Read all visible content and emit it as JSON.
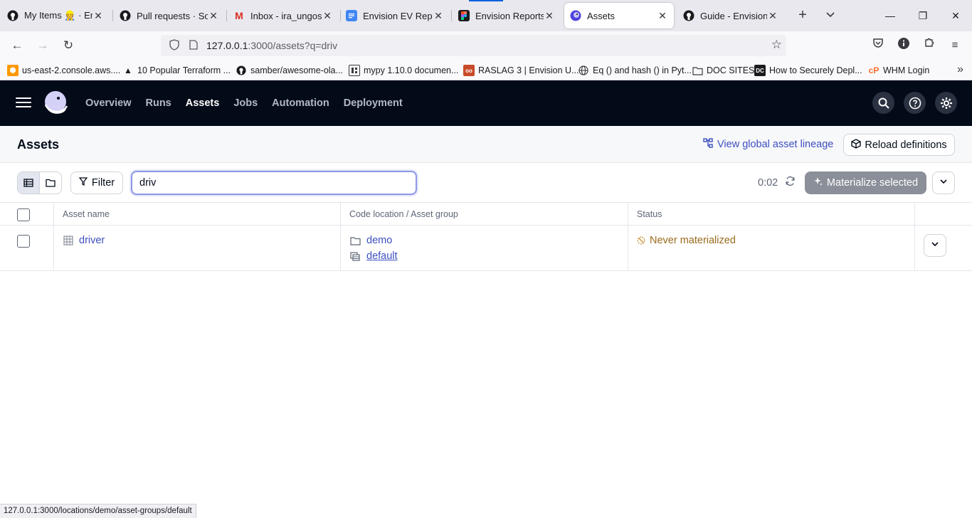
{
  "browser": {
    "tabs": [
      {
        "title": "My Items 👷 · Envis",
        "icon": "github-icon",
        "active": false
      },
      {
        "title": "Pull requests · Sole",
        "icon": "github-icon",
        "active": false
      },
      {
        "title": "Inbox - ira_ungos@",
        "icon": "gmail-icon",
        "active": false
      },
      {
        "title": "Envision EV Report",
        "icon": "google-docs-icon",
        "active": false
      },
      {
        "title": "Envision Reports –",
        "icon": "figma-icon",
        "active": false
      },
      {
        "title": "Assets",
        "icon": "dagster-icon",
        "active": true
      },
      {
        "title": "Guide - Envision EV",
        "icon": "github-icon",
        "active": false
      }
    ],
    "url_host": "127.0.0.1",
    "url_path": ":3000/assets?q=driv",
    "bookmarks": [
      {
        "label": "us-east-2.console.aws....",
        "icon": "aws-icon"
      },
      {
        "label": "10 Popular Terraform ...",
        "icon": "terraform-icon"
      },
      {
        "label": "samber/awesome-ola...",
        "icon": "github-icon"
      },
      {
        "label": "mypy 1.10.0 documen...",
        "icon": "mypy-icon"
      },
      {
        "label": "RASLAG 3 | Envision U...",
        "icon": "raslag-icon"
      },
      {
        "label": "Eq () and hash () in Pyt...",
        "icon": "globe-icon"
      },
      {
        "label": "DOC SITES",
        "icon": "folder-icon"
      },
      {
        "label": "How to Securely Depl...",
        "icon": "dc-icon"
      },
      {
        "label": "WHM Login",
        "icon": "cpanel-icon"
      }
    ],
    "status_url": "127.0.0.1:3000/locations/demo/asset-groups/default"
  },
  "app": {
    "nav": [
      "Overview",
      "Runs",
      "Assets",
      "Jobs",
      "Automation",
      "Deployment"
    ],
    "active_nav": "Assets"
  },
  "page": {
    "title": "Assets",
    "lineage_link": "View global asset lineage",
    "reload_button": "Reload definitions"
  },
  "toolbar": {
    "filter_label": "Filter",
    "search_value": "driv",
    "refresh_time": "0:02",
    "materialize_label": "Materialize selected"
  },
  "table": {
    "columns": [
      "Asset name",
      "Code location / Asset group",
      "Status"
    ],
    "rows": [
      {
        "asset_name": "driver",
        "code_location": "demo",
        "asset_group": "default",
        "status": "Never materialized"
      }
    ]
  },
  "colors": {
    "header_bg": "#030b19",
    "link": "#3d4fbf",
    "status_warning": "#9a6b1c",
    "materialize_disabled": "#8a8f99"
  }
}
